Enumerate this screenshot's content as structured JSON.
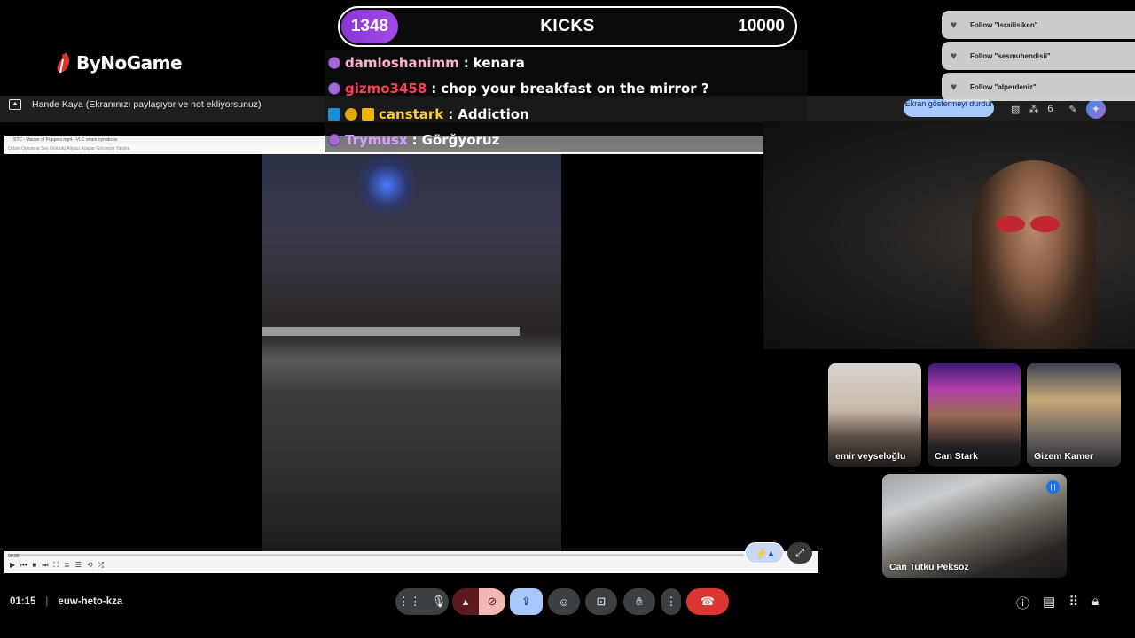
{
  "logo": {
    "text": "ByNoGame"
  },
  "kicks": {
    "count": "1348",
    "title": "KICKS",
    "goal": "10000"
  },
  "chat": [
    {
      "user": "damloshanimm",
      "sep": " : ",
      "message": "kenara",
      "color": "#ffb3d1"
    },
    {
      "user": "gizmo3458",
      "sep": " : ",
      "message": "chop your breakfast on the mirror ?",
      "color": "#ff3d54"
    },
    {
      "user": "canstark",
      "sep": " : ",
      "message": "Addiction",
      "color": "#ffcc33"
    },
    {
      "user": "Trymusx",
      "sep": " : ",
      "message": "Görğyoruz",
      "color": "#d59fff"
    }
  ],
  "follows": [
    {
      "label": "Follow \"israilisiken\""
    },
    {
      "label": "Follow \"sesmuhendisii\""
    },
    {
      "label": "Follow \"alperdeniz\""
    }
  ],
  "presenting": {
    "text": "Hande Kaya (Ekranınızı paylaşıyor ve not ekliyorsunuz)"
  },
  "stop_present": {
    "label": "Ekran göstermeyi durdur"
  },
  "participants_count": "6",
  "vlc": {
    "title": "STC - Master of Puppets.mp4 - VLC ortam oynatıcısı",
    "menu": "Ortam   Oynatma   Ses   Görüntü   Altyazı   Araçlar   Görünüm   Yardım",
    "time": "00:00"
  },
  "participants": [
    {
      "name": "emir veyseloğlu"
    },
    {
      "name": "Can Stark"
    },
    {
      "name": "Gizem Kamer"
    },
    {
      "name": "Can Tutku Peksoz"
    }
  ],
  "meeting": {
    "time": "01:15",
    "sep": "|",
    "code": "euw-heto-kza"
  },
  "colors": {
    "kicks_accent": "#9a40e0",
    "end_call": "#dc3633",
    "present_active": "#a8c7fa"
  }
}
